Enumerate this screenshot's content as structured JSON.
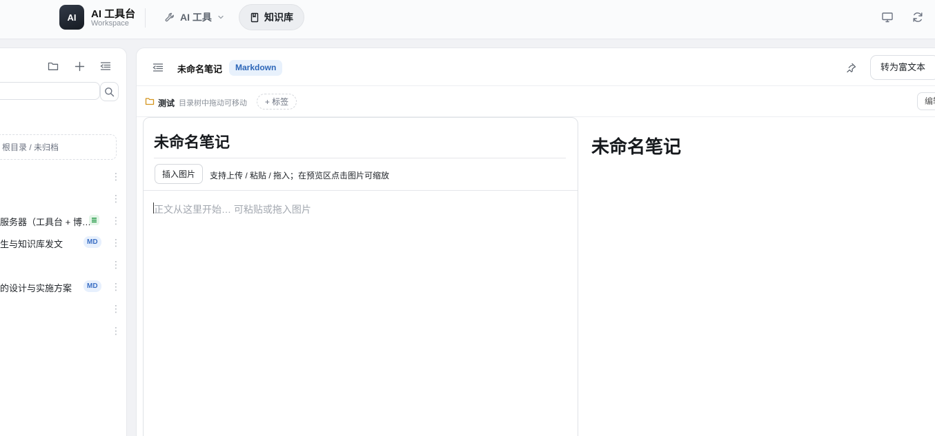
{
  "app": {
    "logo_text": "AI",
    "brand_title": "AI 工具台",
    "brand_subtitle": "Workspace"
  },
  "nav": {
    "ai_tools": "AI 工具",
    "knowledge_base": "知识库"
  },
  "sidebar": {
    "root_label": "根目录 / 未归档",
    "items": [
      {
        "label": ""
      },
      {
        "label": ""
      },
      {
        "label": "服务器（工具台 + 博…",
        "badge": "green"
      },
      {
        "label": "生与知识库发文",
        "badge": "MD"
      },
      {
        "label": ""
      },
      {
        "label": "的设计与实施方案",
        "badge": "MD"
      },
      {
        "label": ""
      },
      {
        "label": ""
      }
    ],
    "more_glyph": "⋮"
  },
  "document": {
    "title": "未命名笔记",
    "format_tag": "Markdown",
    "convert_button": "转为富文本",
    "folder_name": "测试",
    "drag_hint": "目录树中拖动可移动",
    "add_tag": "+ 标签",
    "edit_button": "编辑"
  },
  "editor": {
    "title": "未命名笔记",
    "insert_image": "插入图片",
    "upload_hint": "支持上传 / 粘贴 / 拖入；在预览区点击图片可缩放",
    "body_placeholder": "正文从这里开始… 可粘贴或拖入图片"
  },
  "preview": {
    "title": "未命名笔记"
  },
  "colors": {
    "accent": "#2c66b8",
    "md_badge_bg": "#e7f0fd",
    "green_badge": "#2e9e4f"
  }
}
